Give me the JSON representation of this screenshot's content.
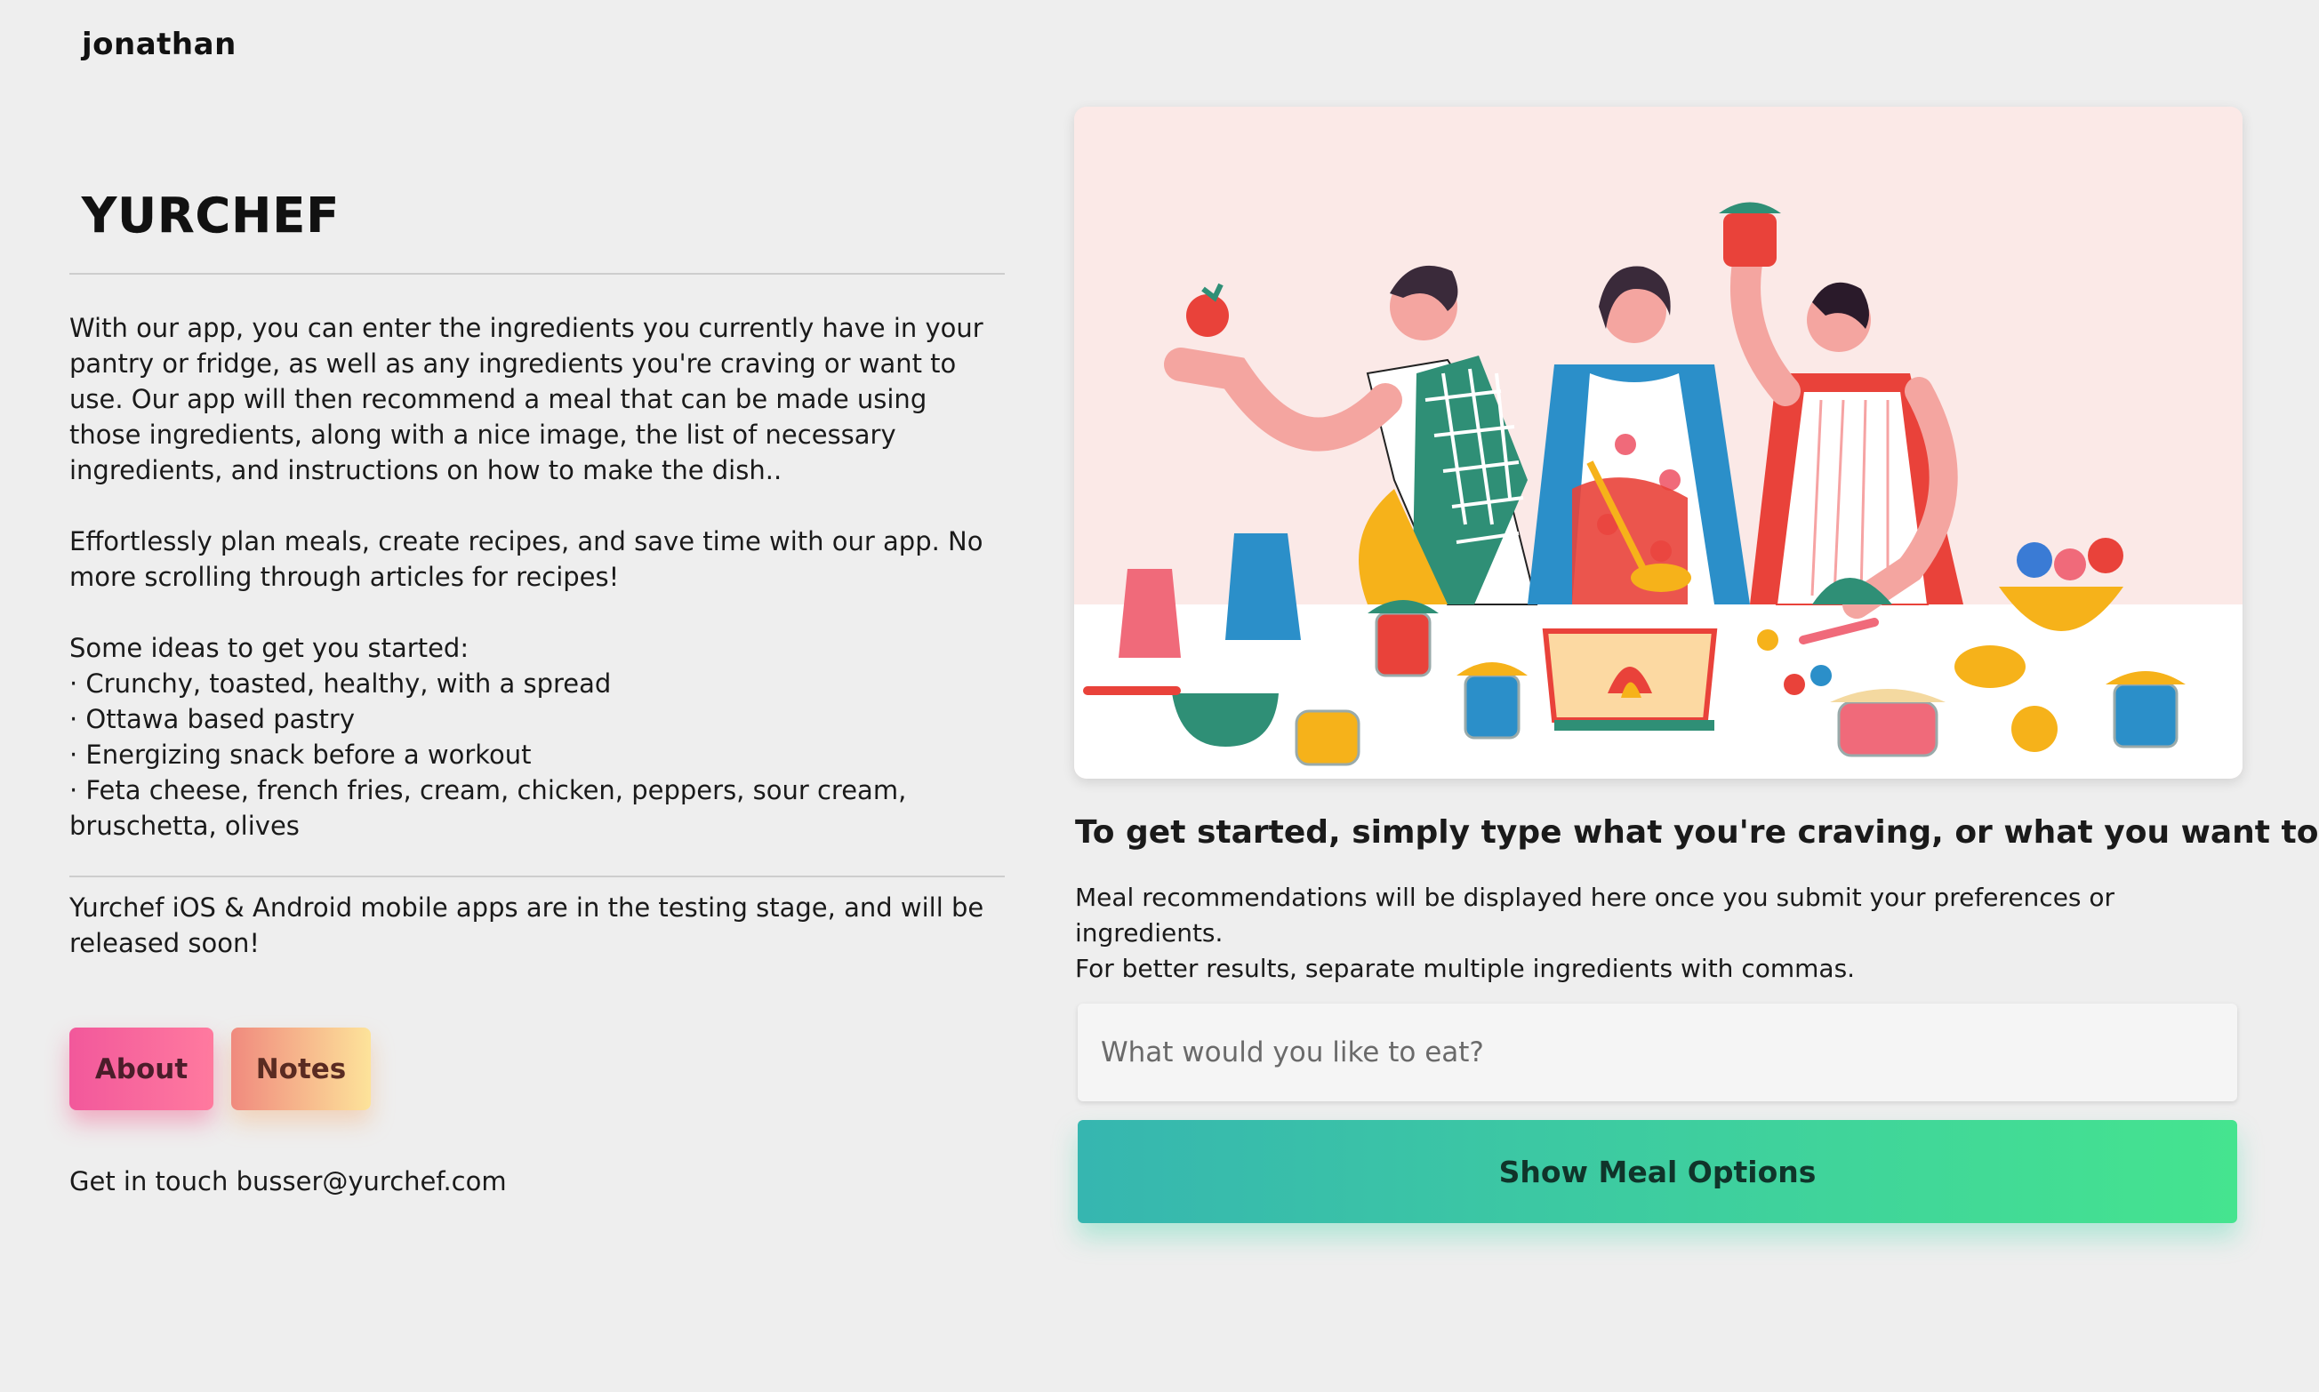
{
  "header": {
    "username": "jonathan"
  },
  "brand": {
    "name": "YURCHEF"
  },
  "intro": {
    "paragraph1": "With our app, you can enter the ingredients you currently have in your pantry or fridge, as well as any ingredients you're craving or want to use. Our app will then recommend a meal that can be made using those ingredients, along with a nice image, the list of necessary ingredients, and instructions on how to make the dish..",
    "paragraph2": "Effortlessly plan meals, create recipes, and save time with our app. No more scrolling through articles for recipes!",
    "ideas_title": "Some ideas to get you started:",
    "ideas": [
      "· Crunchy, toasted, healthy, with a spread",
      "· Ottawa based pastry",
      "· Energizing snack before a workout",
      "· Feta cheese, french fries, cream, chicken, peppers, sour cream, bruschetta, olives"
    ]
  },
  "mobile_note": "Yurchef iOS & Android mobile apps are in the testing stage, and will be released soon!",
  "buttons": {
    "about": "About",
    "notes": "Notes"
  },
  "contact": {
    "text": "Get in touch busser@yurchef.com"
  },
  "main": {
    "hero_icon": "cooking-people-illustration",
    "heading": "To get started, simply type what you're craving, or what you want to use!",
    "subtext_line1": "Meal recommendations will be displayed here once you submit your preferences or ingredients.",
    "subtext_line2": "For better results, separate multiple ingredients with commas.",
    "input_placeholder": "What would you like to eat?",
    "input_value": "",
    "submit_label": "Show Meal Options"
  },
  "colors": {
    "background": "#eeeeee",
    "about_gradient": [
      "#f2589b",
      "#ff7a9f"
    ],
    "notes_gradient": [
      "#f08a7e",
      "#fde39a"
    ],
    "submit_gradient": [
      "#36b6b0",
      "#45e48f"
    ]
  }
}
